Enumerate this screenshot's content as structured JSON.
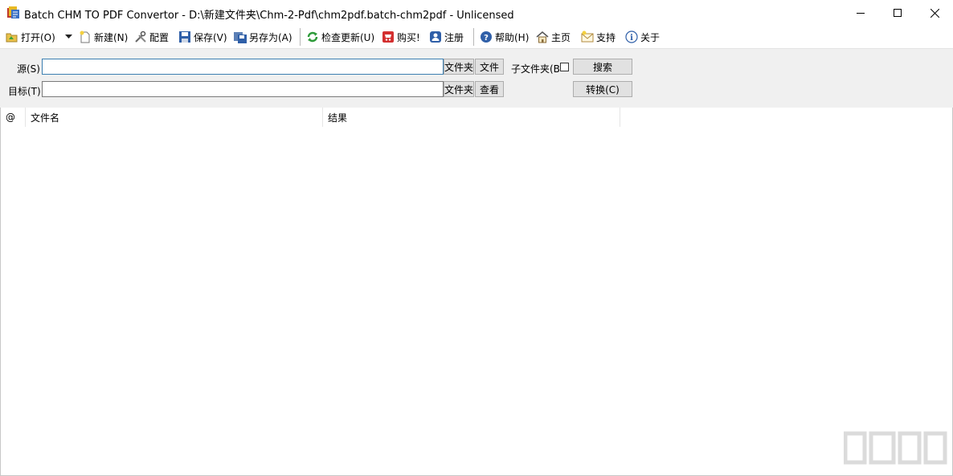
{
  "window": {
    "title": "Batch CHM TO PDF Convertor - D:\\新建文件夹\\Chm-2-Pdf\\chm2pdf.batch-chm2pdf - Unlicensed",
    "app_icon": "app-icon",
    "controls": [
      "minimize-icon",
      "maximize-icon",
      "close-icon"
    ]
  },
  "toolbar": {
    "open": "打开(O)",
    "new": "新建(N)",
    "config": "配置",
    "save": "保存(V)",
    "save_as": "另存为(A)",
    "check_update": "检查更新(U)",
    "buy": "购买!",
    "register": "注册",
    "help": "帮助(H)",
    "home": "主页",
    "support": "支持",
    "about": "关于"
  },
  "form": {
    "source_label": "源(S)",
    "source_value": "",
    "target_label": "目标(T)",
    "target_value": "",
    "folder_button": "文件夹",
    "file_button": "文件",
    "view_button": "查看",
    "subfolder_label": "子文件夹(B",
    "subfolder_checked": false,
    "search_button": "搜索",
    "convert_button": "转换(C)"
  },
  "list": {
    "columns": [
      "@",
      "文件名",
      "结果"
    ],
    "rows": []
  },
  "colors": {
    "panel_bg": "#f0f0f0",
    "button_bg": "#e1e1e1",
    "focus_border": "#3c7fb1"
  }
}
